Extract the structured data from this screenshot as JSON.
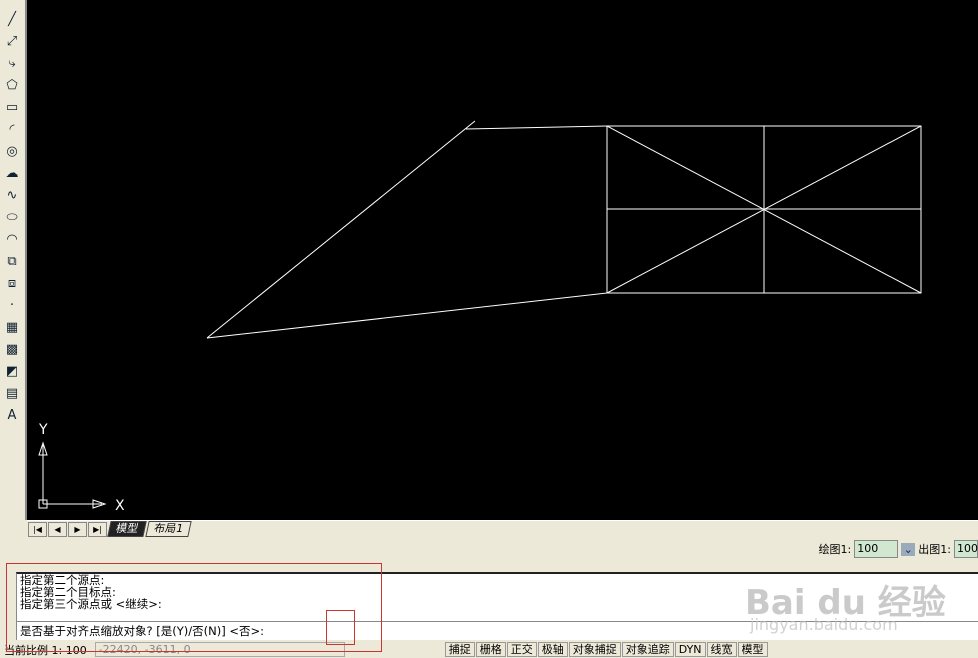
{
  "toolbar": {
    "tools": [
      {
        "icon": "line-icon",
        "g": "╱"
      },
      {
        "icon": "construction-line-icon",
        "g": "⤢"
      },
      {
        "icon": "polyline-icon",
        "g": "⤷"
      },
      {
        "icon": "polygon-icon",
        "g": "⬠"
      },
      {
        "icon": "rectangle-icon",
        "g": "▭"
      },
      {
        "icon": "arc-icon",
        "g": "◜"
      },
      {
        "icon": "circle-icon",
        "g": "◎"
      },
      {
        "icon": "revcloud-icon",
        "g": "☁"
      },
      {
        "icon": "spline-icon",
        "g": "∿"
      },
      {
        "icon": "ellipse-icon",
        "g": "⬭"
      },
      {
        "icon": "ellipse-arc-icon",
        "g": "◠"
      },
      {
        "icon": "insert-block-icon",
        "g": "⧉"
      },
      {
        "icon": "make-block-icon",
        "g": "⧈"
      },
      {
        "icon": "point-icon",
        "g": "·"
      },
      {
        "icon": "hatch-icon",
        "g": "▦"
      },
      {
        "icon": "gradient-icon",
        "g": "▩"
      },
      {
        "icon": "region-icon",
        "g": "◩"
      },
      {
        "icon": "table-icon",
        "g": "▤"
      },
      {
        "icon": "mtext-icon",
        "g": "A"
      }
    ]
  },
  "ucs": {
    "x": "X",
    "y": "Y"
  },
  "tabs": {
    "nav": [
      "|◀",
      "◀",
      "▶",
      "▶|"
    ],
    "items": [
      "模型",
      "布局1"
    ]
  },
  "scale": {
    "draw_label": "绘图1:",
    "draw_value": "100",
    "plot_label": "出图1:",
    "plot_value": "100"
  },
  "command": {
    "history": [
      "指定第二个源点:",
      "指定第二个目标点:",
      "指定第三个源点或 <继续>:"
    ],
    "prompt": "是否基于对齐点缩放对象? [是(Y)/否(N)] <否>:"
  },
  "status": {
    "scale": "当前比例 1: 100",
    "coords": "-22420, -3611, 0",
    "buttons": [
      "捕捉",
      "栅格",
      "正交",
      "极轴",
      "对象捕捉",
      "对象追踪",
      "DYN",
      "线宽",
      "模型"
    ]
  },
  "watermark": {
    "brand": "Baidu经验",
    "url": "jingyan.baidu.com"
  }
}
